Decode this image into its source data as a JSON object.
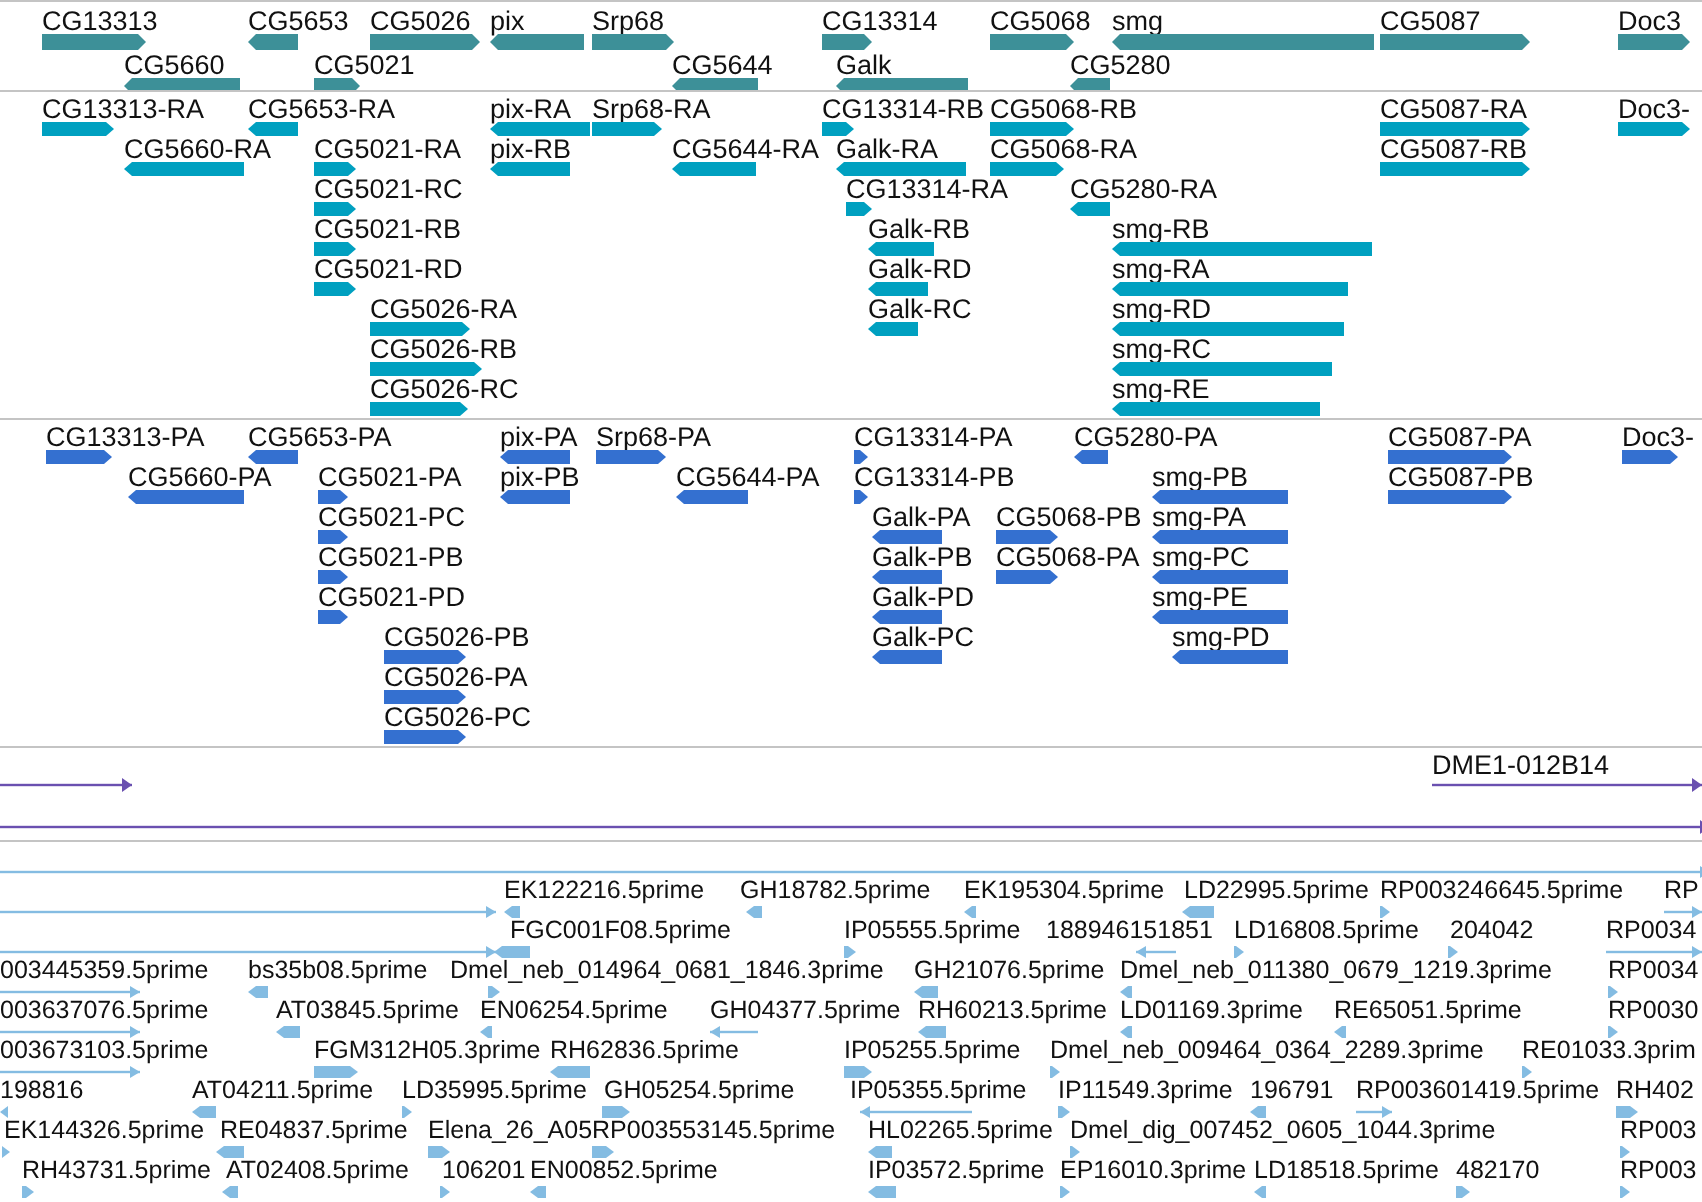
{
  "tracks": [
    {
      "kind": "genes",
      "features": [
        {
          "label": "CG13313",
          "reverse": false
        },
        {
          "label": "CG5660",
          "reverse": true
        },
        {
          "label": "CG5653",
          "reverse": true
        },
        {
          "label": "CG5021",
          "reverse": false
        },
        {
          "label": "CG5026",
          "reverse": false
        },
        {
          "label": "pix",
          "reverse": true
        },
        {
          "label": "Srp68",
          "reverse": false
        },
        {
          "label": "CG5644",
          "reverse": true
        },
        {
          "label": "CG13314",
          "reverse": false
        },
        {
          "label": "Galk",
          "reverse": true
        },
        {
          "label": "CG5068",
          "reverse": false
        },
        {
          "label": "CG5280",
          "reverse": true
        },
        {
          "label": "smg",
          "reverse": true
        },
        {
          "label": "CG5087",
          "reverse": false
        },
        {
          "label": "Doc3",
          "reverse": false
        }
      ]
    },
    {
      "kind": "transcripts",
      "features": [
        {
          "label": "CG13313-RA",
          "reverse": false
        },
        {
          "label": "CG5653-RA",
          "reverse": true
        },
        {
          "label": "CG5660-RA",
          "reverse": true
        },
        {
          "label": "CG5021-RA",
          "reverse": false
        },
        {
          "label": "CG5021-RC",
          "reverse": false
        },
        {
          "label": "CG5021-RB",
          "reverse": false
        },
        {
          "label": "CG5021-RD",
          "reverse": false
        },
        {
          "label": "CG5026-RA",
          "reverse": false
        },
        {
          "label": "CG5026-RB",
          "reverse": false
        },
        {
          "label": "CG5026-RC",
          "reverse": false
        },
        {
          "label": "pix-RA",
          "reverse": true
        },
        {
          "label": "pix-RB",
          "reverse": true
        },
        {
          "label": "Srp68-RA",
          "reverse": false
        },
        {
          "label": "CG5644-RA",
          "reverse": true
        },
        {
          "label": "CG13314-RB",
          "reverse": false
        },
        {
          "label": "Galk-RA",
          "reverse": true
        },
        {
          "label": "CG13314-RA",
          "reverse": false
        },
        {
          "label": "Galk-RB",
          "reverse": true
        },
        {
          "label": "Galk-RD",
          "reverse": true
        },
        {
          "label": "Galk-RC",
          "reverse": true
        },
        {
          "label": "CG5068-RB",
          "reverse": false
        },
        {
          "label": "CG5068-RA",
          "reverse": false
        },
        {
          "label": "CG5280-RA",
          "reverse": true
        },
        {
          "label": "smg-RB",
          "reverse": true
        },
        {
          "label": "smg-RA",
          "reverse": true
        },
        {
          "label": "smg-RD",
          "reverse": true
        },
        {
          "label": "smg-RC",
          "reverse": true
        },
        {
          "label": "smg-RE",
          "reverse": true
        },
        {
          "label": "CG5087-RA",
          "reverse": false
        },
        {
          "label": "CG5087-RB",
          "reverse": false
        },
        {
          "label": "Doc3-",
          "reverse": false
        }
      ]
    },
    {
      "kind": "proteins",
      "features": [
        {
          "label": "CG13313-PA",
          "reverse": false
        },
        {
          "label": "CG5653-PA",
          "reverse": true
        },
        {
          "label": "CG5660-PA",
          "reverse": true
        },
        {
          "label": "CG5021-PA",
          "reverse": false
        },
        {
          "label": "CG5021-PC",
          "reverse": false
        },
        {
          "label": "CG5021-PB",
          "reverse": false
        },
        {
          "label": "CG5021-PD",
          "reverse": false
        },
        {
          "label": "CG5026-PB",
          "reverse": false
        },
        {
          "label": "CG5026-PA",
          "reverse": false
        },
        {
          "label": "CG5026-PC",
          "reverse": false
        },
        {
          "label": "pix-PA",
          "reverse": true
        },
        {
          "label": "pix-PB",
          "reverse": true
        },
        {
          "label": "Srp68-PA",
          "reverse": false
        },
        {
          "label": "CG5644-PA",
          "reverse": true
        },
        {
          "label": "CG13314-PA",
          "reverse": false
        },
        {
          "label": "CG13314-PB",
          "reverse": false
        },
        {
          "label": "Galk-PA",
          "reverse": true
        },
        {
          "label": "Galk-PB",
          "reverse": true
        },
        {
          "label": "Galk-PD",
          "reverse": true
        },
        {
          "label": "Galk-PC",
          "reverse": true
        },
        {
          "label": "CG5068-PB",
          "reverse": false
        },
        {
          "label": "CG5068-PA",
          "reverse": false
        },
        {
          "label": "CG5280-PA",
          "reverse": true
        },
        {
          "label": "smg-PB",
          "reverse": true
        },
        {
          "label": "smg-PA",
          "reverse": true
        },
        {
          "label": "smg-PC",
          "reverse": true
        },
        {
          "label": "smg-PE",
          "reverse": true
        },
        {
          "label": "smg-PD",
          "reverse": true
        },
        {
          "label": "CG5087-PA",
          "reverse": false
        },
        {
          "label": "CG5087-PB",
          "reverse": false
        },
        {
          "label": "Doc3-",
          "reverse": false
        }
      ]
    },
    {
      "kind": "clones",
      "features": [
        {
          "reverse": false
        },
        {
          "label": "DME1-012B14",
          "reverse": false
        },
        {
          "reverse": false
        }
      ]
    },
    {
      "kind": "ests",
      "features": [
        {
          "reverse": false
        },
        {
          "reverse": false
        },
        {
          "label": "EK122216.5prime",
          "reverse": true
        },
        {
          "label": "GH18782.5prime",
          "reverse": true
        },
        {
          "label": "EK195304.5prime",
          "reverse": true
        },
        {
          "label": "LD22995.5prime",
          "reverse": true
        },
        {
          "label": "RP003246645.5prime",
          "reverse": false
        },
        {
          "label": "RP",
          "reverse": false
        },
        {
          "reverse": false
        },
        {
          "label": "FGC001F08.5prime",
          "reverse": true
        },
        {
          "label": "IP05555.5prime",
          "reverse": false
        },
        {
          "label": "188946151851",
          "reverse": true
        },
        {
          "label": "LD16808.5prime",
          "reverse": false
        },
        {
          "label": "204042",
          "reverse": false
        },
        {
          "label": "RP0034",
          "reverse": false
        },
        {
          "label": "003445359.5prime",
          "reverse": false
        },
        {
          "label": "bs35b08.5prime",
          "reverse": true
        },
        {
          "label": "Dmel_neb_014964_0681_1846.3prime",
          "reverse": false
        },
        {
          "label": "GH21076.5prime",
          "reverse": true
        },
        {
          "label": "Dmel_neb_011380_0679_1219.3prime",
          "reverse": true
        },
        {
          "label": "RP0034",
          "reverse": false
        },
        {
          "label": "003637076.5prime",
          "reverse": false
        },
        {
          "label": "AT03845.5prime",
          "reverse": true
        },
        {
          "label": "EN06254.5prime",
          "reverse": true
        },
        {
          "label": "GH04377.5prime",
          "reverse": true
        },
        {
          "label": "RH60213.5prime",
          "reverse": true
        },
        {
          "label": "LD01169.3prime",
          "reverse": true
        },
        {
          "label": "RE65051.5prime",
          "reverse": true
        },
        {
          "label": "RP0030",
          "reverse": false
        },
        {
          "label": "003673103.5prime",
          "reverse": false
        },
        {
          "label": "FGM312H05.3prime",
          "reverse": false
        },
        {
          "label": "RH62836.5prime",
          "reverse": true
        },
        {
          "label": "IP05255.5prime",
          "reverse": false
        },
        {
          "label": "Dmel_neb_009464_0364_2289.3prime",
          "reverse": false
        },
        {
          "label": "RE01033.3prim",
          "reverse": false
        },
        {
          "label": "198816",
          "reverse": true
        },
        {
          "label": "AT04211.5prime",
          "reverse": true
        },
        {
          "label": "LD35995.5prime",
          "reverse": false
        },
        {
          "label": "GH05254.5prime",
          "reverse": false
        },
        {
          "label": "IP05355.5prime",
          "reverse": true
        },
        {
          "label": "IP11549.3prime",
          "reverse": false
        },
        {
          "label": "196791",
          "reverse": true
        },
        {
          "label": "RP003601419.5prime",
          "reverse": false
        },
        {
          "label": "RH402",
          "reverse": false
        },
        {
          "label": "EK144326.5prime",
          "reverse": false
        },
        {
          "label": "RE04837.5prime",
          "reverse": true
        },
        {
          "label": "Elena_26_A05",
          "reverse": false
        },
        {
          "label": "RP003553145.5prime",
          "reverse": false
        },
        {
          "label": "HL02265.5prime",
          "reverse": true
        },
        {
          "label": "Dmel_dig_007452_0605_1044.3prime",
          "reverse": false
        },
        {
          "label": "RP003",
          "reverse": false
        },
        {
          "label": "RH43731.5prime",
          "reverse": false
        },
        {
          "label": "AT02408.5prime",
          "reverse": true
        },
        {
          "label": "106201",
          "reverse": false
        },
        {
          "label": "EN00852.5prime",
          "reverse": true
        },
        {
          "label": "IP03572.5prime",
          "reverse": true
        },
        {
          "label": "EP16010.3prime",
          "reverse": false
        },
        {
          "label": "LD18518.5prime",
          "reverse": true
        },
        {
          "label": "482170",
          "reverse": false
        },
        {
          "label": "RP003",
          "reverse": false
        }
      ]
    }
  ]
}
